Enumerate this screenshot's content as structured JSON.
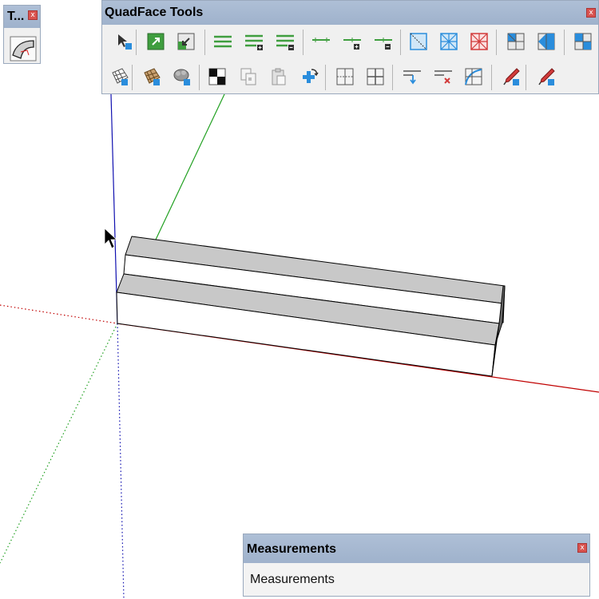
{
  "small_toolbar": {
    "title": "T...",
    "close_glyph": "x",
    "tool_icon": "curved-surface-icon"
  },
  "quadface_toolbar": {
    "title": "QuadFace Tools",
    "close_glyph": "x",
    "row1_icons": [
      "select-quad-icon",
      "grow-selection-icon",
      "shrink-selection-icon",
      "select-ring-icon",
      "grow-ring-icon",
      "shrink-ring-icon",
      "select-loop-icon",
      "grow-loop-icon",
      "shrink-loop-icon",
      "region-to-loop-icon",
      "select-bounding-loop-icon",
      "deselect-loop-icon",
      "triangulate-icon",
      "remove-triangulation-icon",
      "smart-triangulate-icon"
    ],
    "row2_icons": [
      "uv-grid-icon",
      "uv-map-icon",
      "unwrap-uv-icon",
      "checker-pattern-icon",
      "copy-uv-icon",
      "paste-uv-icon",
      "offset-loop-icon",
      "insert-loops-icon",
      "connect-edges-icon",
      "build-corners-icon",
      "build-ends-icon",
      "remove-loops-icon",
      "flip-edge-icon",
      "wireframe-pencil-icon",
      "make-planar-icon"
    ]
  },
  "measurements": {
    "title": "Measurements",
    "close_glyph": "x",
    "field_label": "Measurements"
  },
  "colors": {
    "panel_title": "#a9bcd3",
    "axis_red": "#c00000",
    "axis_green": "#20a020",
    "axis_blue": "#1010b0",
    "top_face": "#c8c8c8",
    "front_face": "#ffffff"
  }
}
